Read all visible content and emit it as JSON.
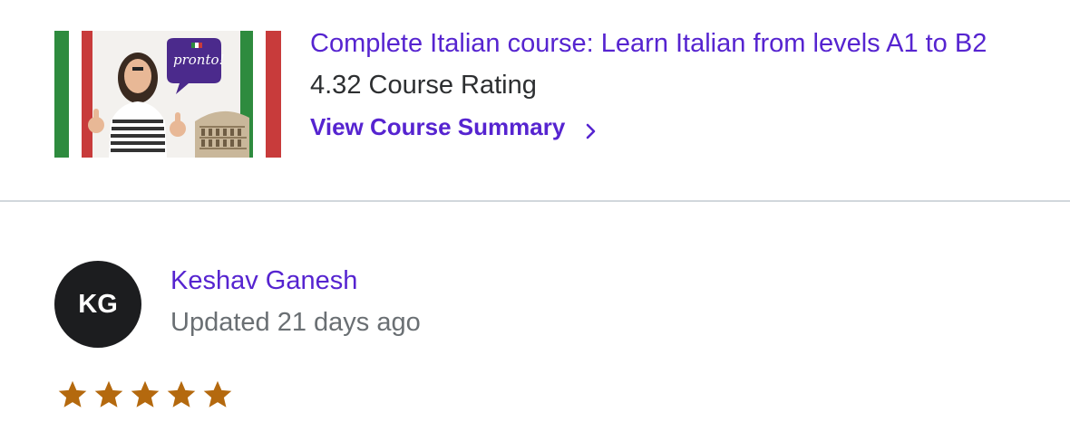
{
  "course": {
    "title": "Complete Italian course: Learn Italian from levels A1 to B2",
    "rating_text": "4.32 Course Rating",
    "summary_link": "View Course Summary",
    "thumbnail_badge": "pronto!"
  },
  "review": {
    "avatar_initials": "KG",
    "reviewer_name": "Keshav Ganesh",
    "updated_text": "Updated 21 days ago",
    "stars": 5,
    "star_color": "#b4690e"
  },
  "colors": {
    "link": "#5624d0",
    "text": "#2d2f31",
    "muted": "#6a6f73",
    "avatar_bg": "#1c1d1f",
    "divider": "#d1d7dc"
  }
}
